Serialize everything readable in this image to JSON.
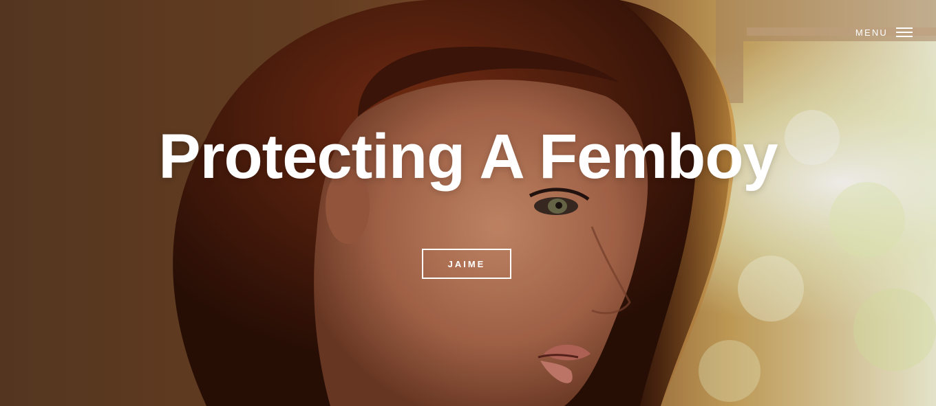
{
  "header": {
    "menu_label": "MENU",
    "menu_icon": "hamburger-icon"
  },
  "hero": {
    "title": "Protecting A Femboy",
    "cta_label": "JAIME",
    "background_image": "portrait of a woman with long auburn hair in profile near a sunlit window"
  },
  "colors": {
    "text": "#ffffff",
    "button_border": "#ffffff",
    "background_dark": "#4a2c1a",
    "window_light": "#e8edc8"
  }
}
